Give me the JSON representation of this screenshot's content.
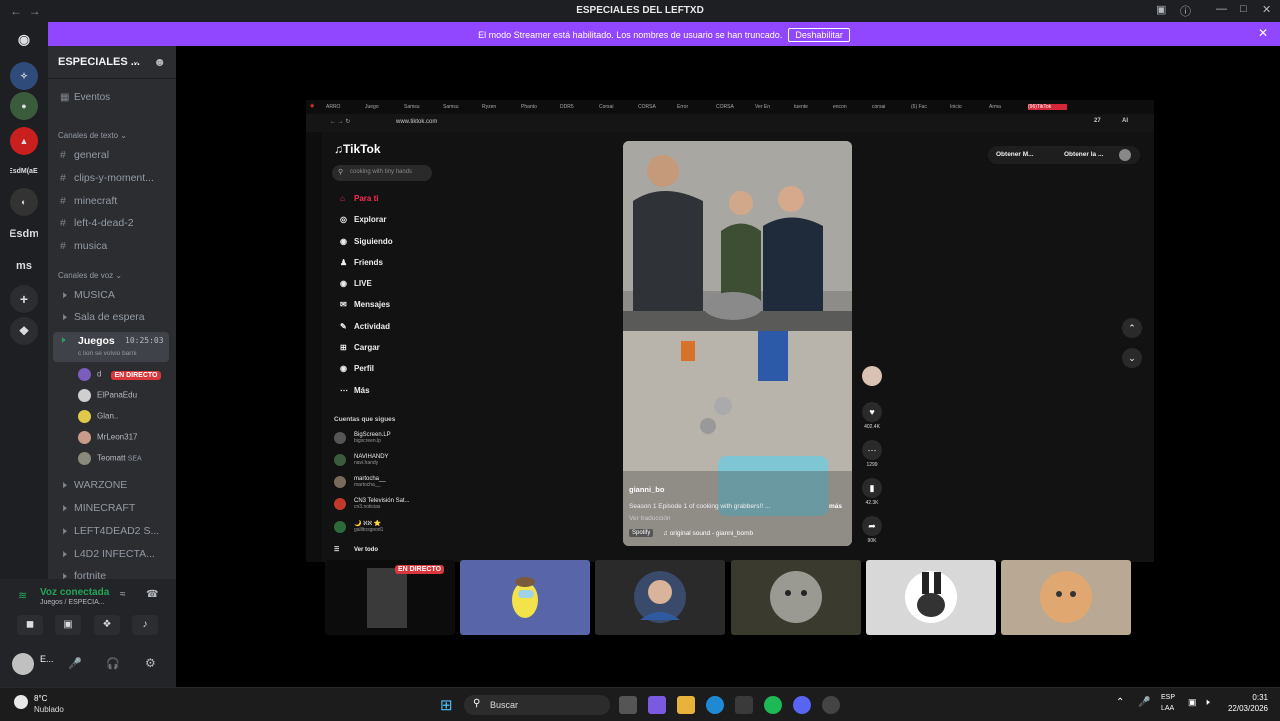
{
  "window": {
    "title": "ESPECIALES DEL LEFTXD"
  },
  "banner": {
    "text": "El modo Streamer está habilitado. Los nombres de usuario se han truncado.",
    "button": "Deshabilitar"
  },
  "servers": [
    {
      "label": "EsdM(aE)"
    },
    {
      "label": "Esdm"
    },
    {
      "label": "ms"
    }
  ],
  "guild": {
    "name": "ESPECIALES ..."
  },
  "sidebar": {
    "events": "Eventos",
    "text_category": "Canales de texto",
    "text_channels": [
      "general",
      "clips-y-moment...",
      "minecraft",
      "left-4-dead-2",
      "musica"
    ],
    "voice_category": "Canales de voz",
    "voice_channels_top": [
      "MUSICA",
      "Sala de espera"
    ],
    "active_channel": {
      "name": "Juegos",
      "timer": "10:25:03",
      "status": "c lion se volvio barni"
    },
    "users": [
      {
        "name": "d",
        "badge": "EN DIRECTO"
      },
      {
        "name": "ElPanaEdu"
      },
      {
        "name": "Glan.."
      },
      {
        "name": "MrLeon317"
      },
      {
        "name": "Teomatt",
        "extra": "SEA"
      }
    ],
    "voice_channels_bottom": [
      "WARZONE",
      "MINECRAFT",
      "LEFT4DEAD2 S...",
      "L4D2 INFECTA...",
      "fortnite"
    ]
  },
  "voice_panel": {
    "status": "Voz conectada",
    "channel": "Juegos / ESPECIA...",
    "user": "E..."
  },
  "browser": {
    "url": "www.tiktok.com",
    "tabs": [
      "ARRO",
      "Juego",
      "Samsu",
      "Samsu",
      "Ryzen",
      "Phanto",
      "DDR5",
      "Corsai",
      "CORSA",
      "Error",
      "CORSA",
      "Ver En",
      "tuente",
      "encon",
      "corsai",
      "(6) Fac",
      "Inicio",
      "Arma",
      "(96)TikTok"
    ],
    "extensions_count": "27",
    "extensions_ai": "AI"
  },
  "tiktok": {
    "logo": "TikTok",
    "search_placeholder": "cooking with tiny hands",
    "nav": [
      {
        "label": "Para ti",
        "icon": "home-icon"
      },
      {
        "label": "Explorar",
        "icon": "compass-icon"
      },
      {
        "label": "Siguiendo",
        "icon": "following-icon"
      },
      {
        "label": "Friends",
        "icon": "friends-icon"
      },
      {
        "label": "LIVE",
        "icon": "live-icon"
      },
      {
        "label": "Mensajes",
        "icon": "message-icon"
      },
      {
        "label": "Actividad",
        "icon": "activity-icon"
      },
      {
        "label": "Cargar",
        "icon": "upload-icon"
      },
      {
        "label": "Perfil",
        "icon": "profile-icon"
      },
      {
        "label": "Más",
        "icon": "more-icon"
      }
    ],
    "following_title": "Cuentas que sigues",
    "following": [
      {
        "name": "BigScreen.LP",
        "handle": "bigscreen.lp"
      },
      {
        "name": "NAVIHANDY",
        "handle": "navi.handy"
      },
      {
        "name": "martocha__",
        "handle": "martocha__"
      },
      {
        "name": "CN3 Televisión Sat...",
        "handle": "cn3.noticias"
      },
      {
        "name": "🌙 ℵℵ ⭐",
        "handle": "gallitosgood1"
      }
    ],
    "see_all": "Ver todo",
    "get_buttons": [
      "Obtener M...",
      "Obtener la ..."
    ],
    "video": {
      "author": "gianni_bo",
      "caption": "Season 1 Episode 1 of cooking with grabbers!! ...",
      "more": "más",
      "translate": "Ver traducción",
      "spotify": "Spotify",
      "sound": "original sound - gianni_bomb"
    },
    "stats": {
      "likes": "402.4K",
      "comments": "1299",
      "saves": "42.3K",
      "shares": "90K"
    }
  },
  "tiles": [
    {
      "badge": "EN DIRECTO"
    }
  ],
  "taskbar": {
    "weather_temp": "8°C",
    "weather_desc": "Nublado",
    "search": "Buscar",
    "lang": "ESP",
    "lang2": "LAA",
    "time": "0:31",
    "date": "22/03/2026"
  }
}
